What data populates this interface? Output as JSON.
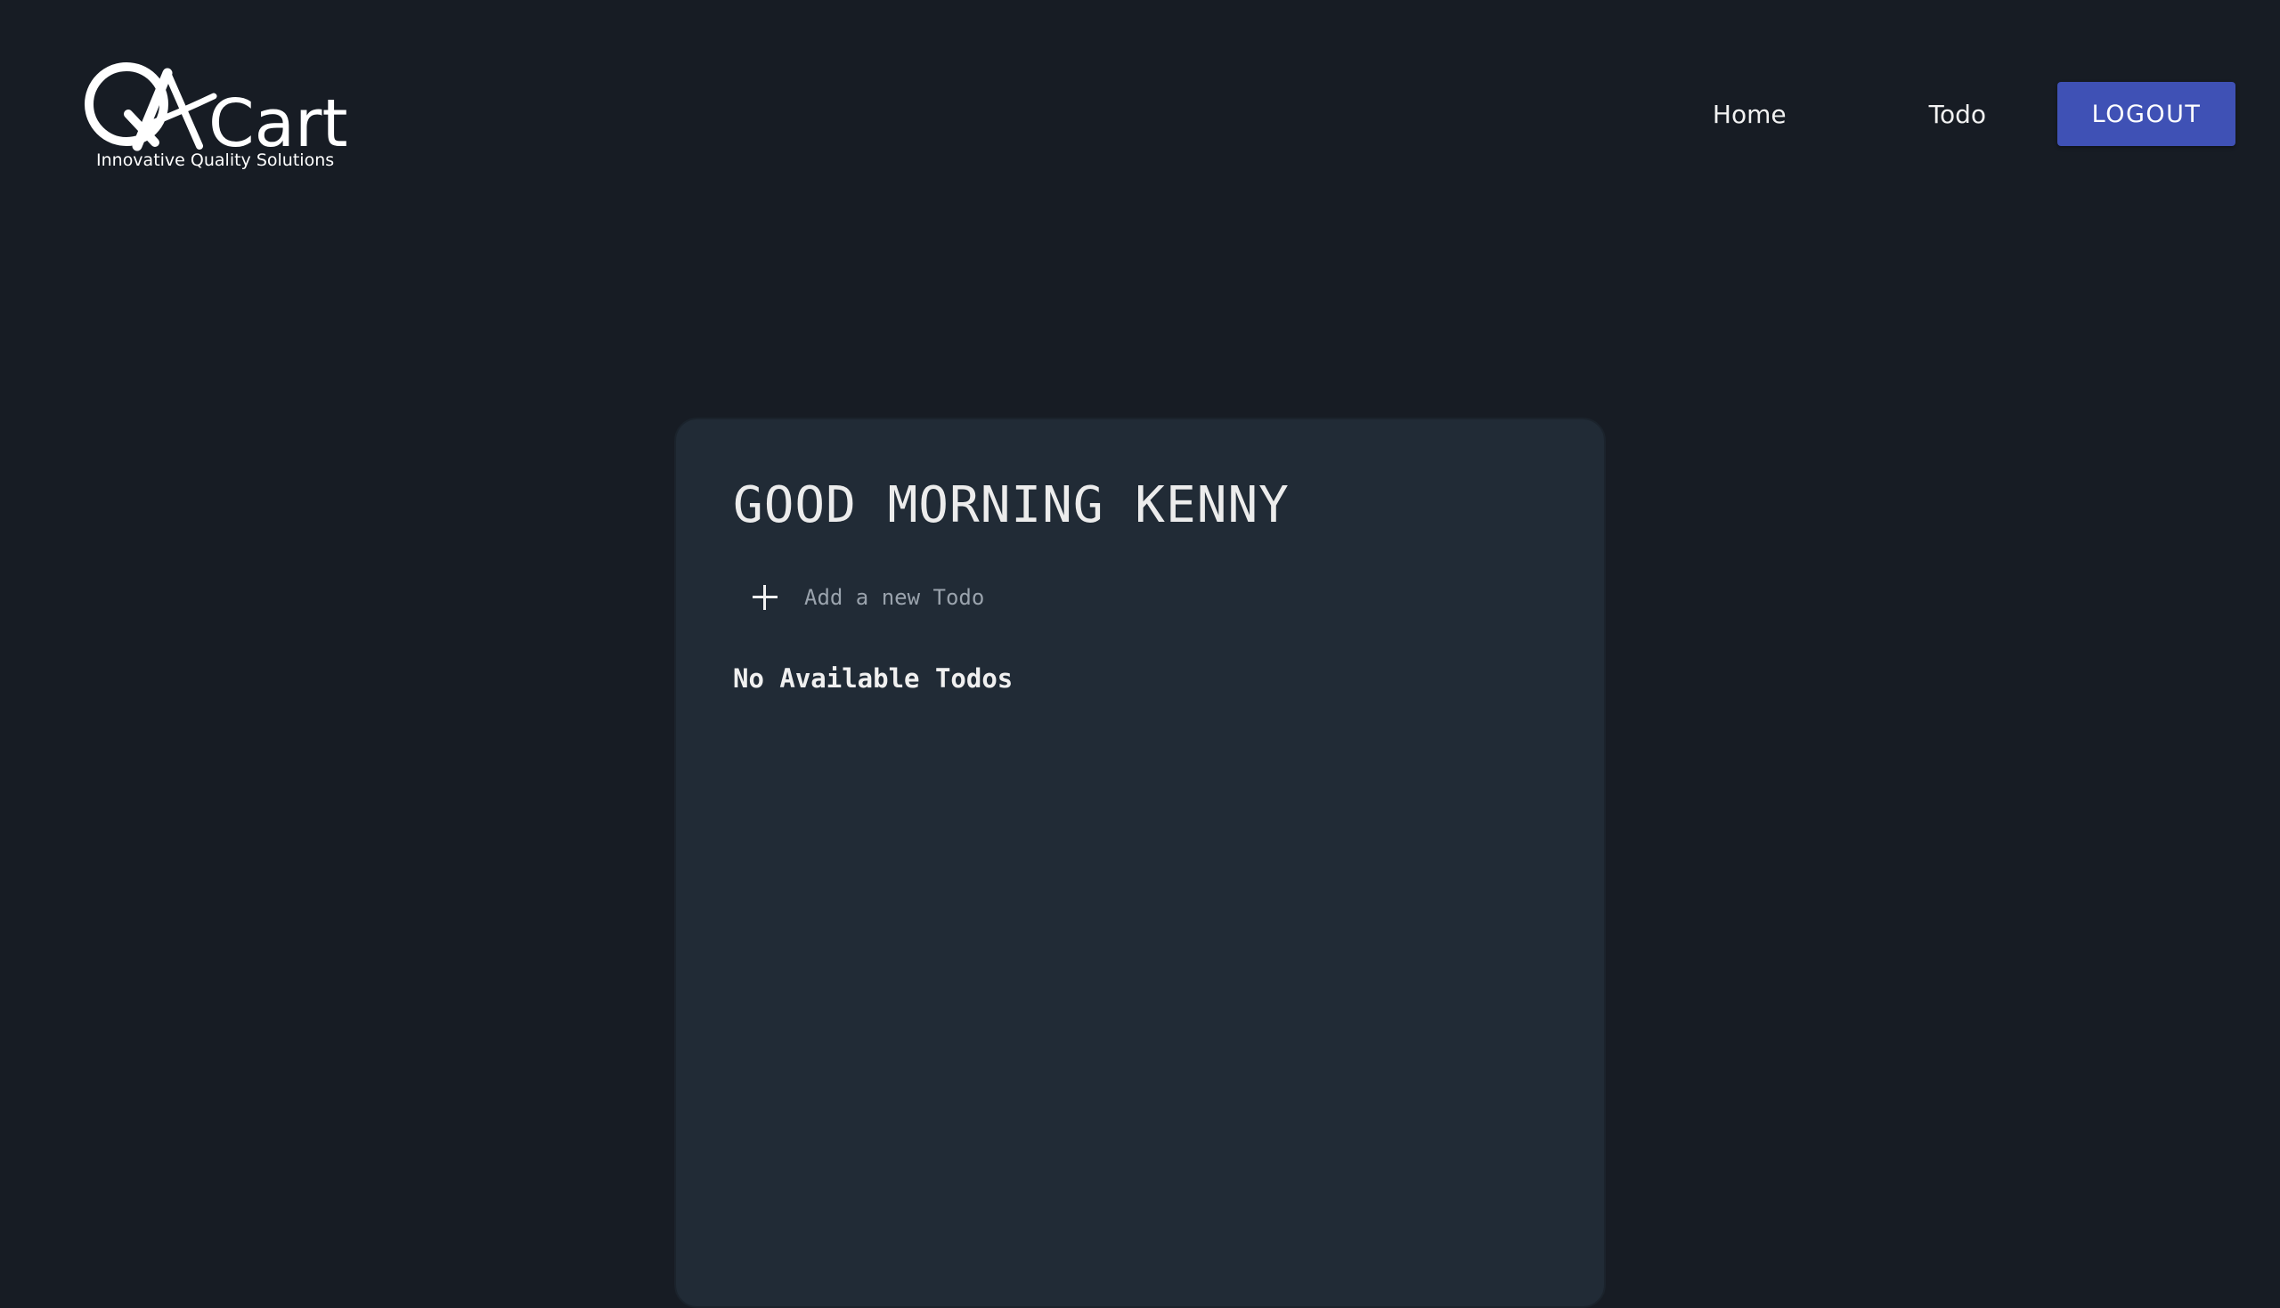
{
  "brand": {
    "logo_text": "QACart",
    "tagline": "Innovative Quality Solutions"
  },
  "nav": {
    "home_label": "Home",
    "todo_label": "Todo",
    "logout_label": "LOGOUT"
  },
  "todo_card": {
    "greeting": "GOOD MORNING KENNY",
    "add_placeholder": "Add a new Todo",
    "empty_message": "No Available Todos"
  },
  "colors": {
    "page_background": "#171c24",
    "card_background": "#212b36",
    "logout_button": "#3f51b5"
  },
  "icons": {
    "add": "plus-icon"
  }
}
